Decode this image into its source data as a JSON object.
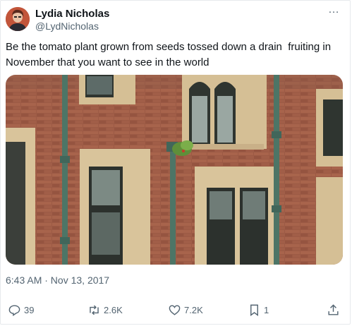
{
  "user": {
    "name": "Lydia Nicholas",
    "handle": "@LydNicholas"
  },
  "tweet": {
    "text": "Be the tomato plant grown from seeds tossed down a drain  fruiting in November that you want to see in the world",
    "timestamp": "6:43 AM · Nov 13, 2017"
  },
  "menu": {
    "more_icon": "…"
  },
  "actions": {
    "replies": "39",
    "retweets": "2.6K",
    "likes": "7.2K",
    "bookmarks": "1"
  }
}
